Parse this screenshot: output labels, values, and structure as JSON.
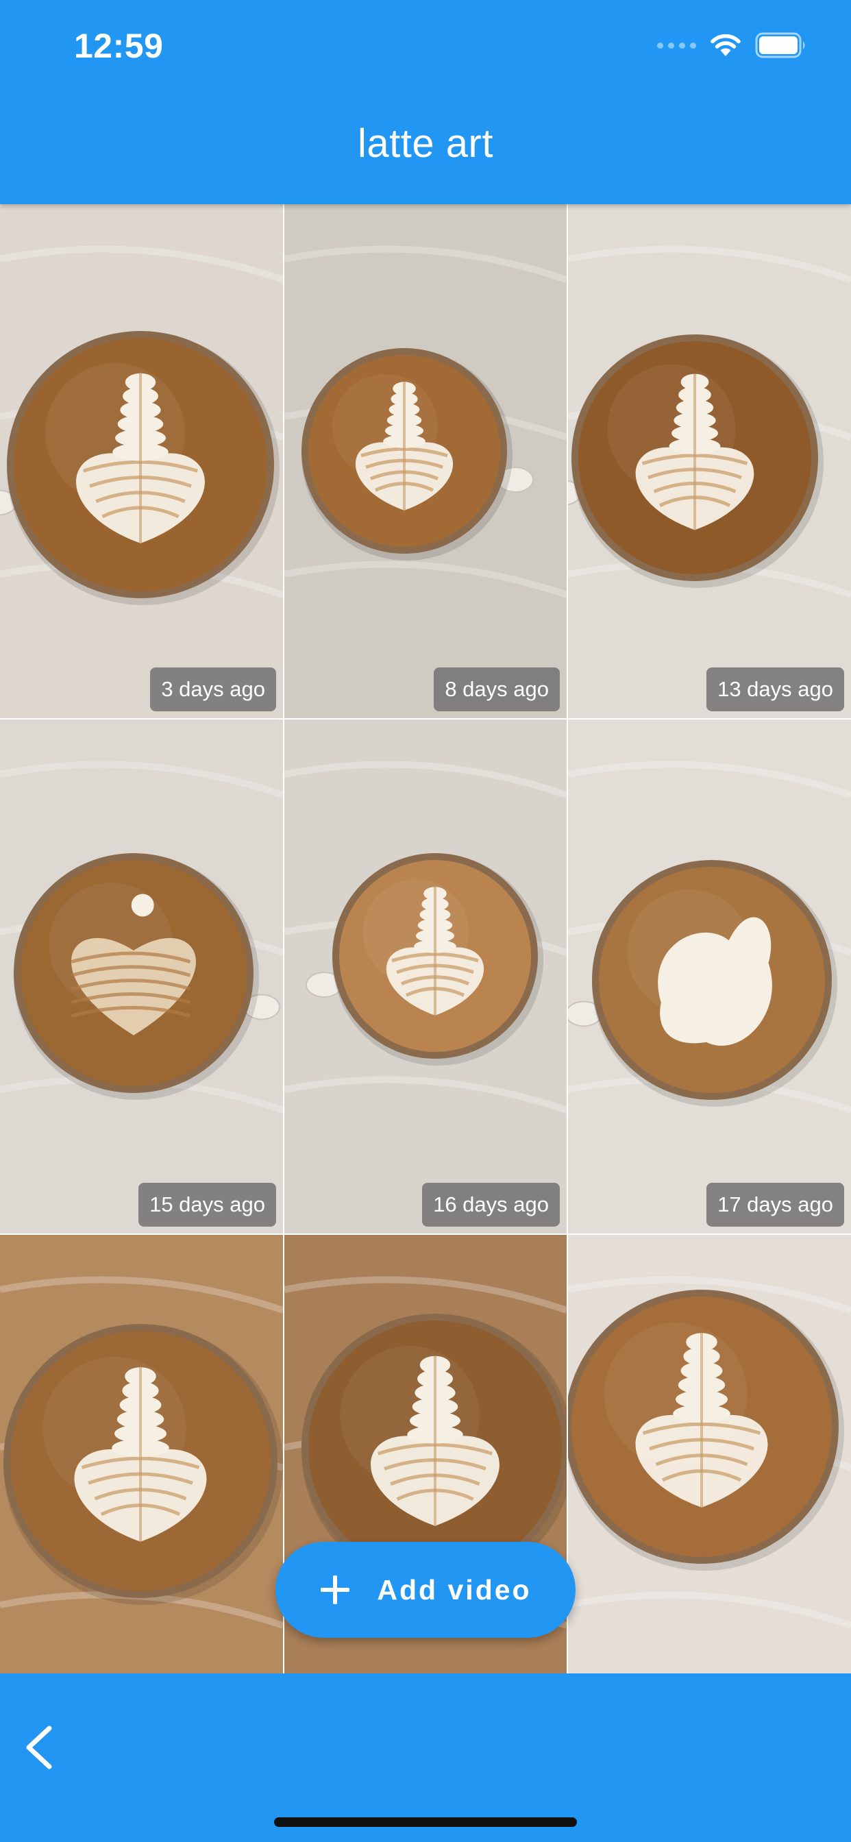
{
  "status_bar": {
    "time": "12:59"
  },
  "app_bar": {
    "title": "latte art"
  },
  "colors": {
    "primary": "#2196F3",
    "badge_background": "#6e6e6e"
  },
  "videos": [
    {
      "age_label": "3 days ago"
    },
    {
      "age_label": "8 days ago"
    },
    {
      "age_label": "13 days ago"
    },
    {
      "age_label": "15 days ago"
    },
    {
      "age_label": "16 days ago"
    },
    {
      "age_label": "17 days ago"
    },
    {
      "age_label": ""
    },
    {
      "age_label": ""
    },
    {
      "age_label": ""
    }
  ],
  "fab": {
    "label": "Add video",
    "icon": "plus-icon"
  },
  "bottom_bar": {
    "back_icon": "chevron-left-icon"
  }
}
